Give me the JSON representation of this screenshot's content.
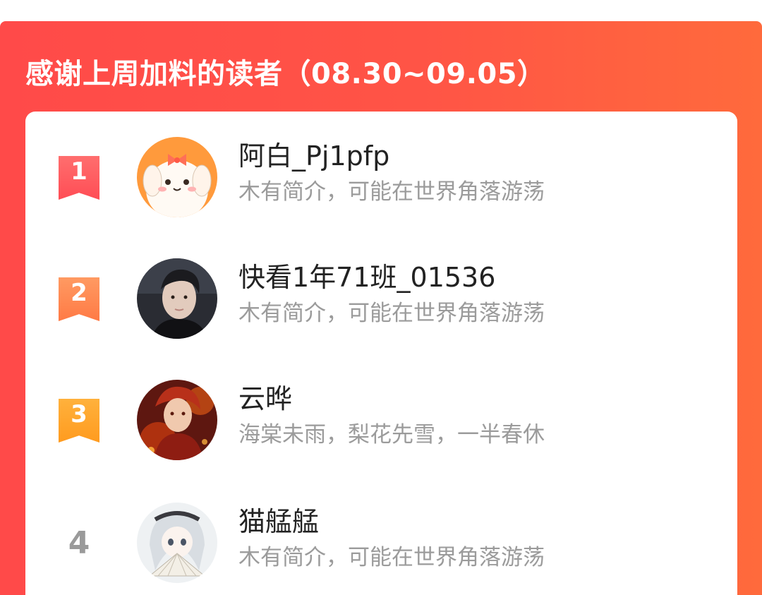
{
  "banner": {
    "title": "感谢上周加料的读者（08.30~09.05）"
  },
  "readers": [
    {
      "rank": "1",
      "name": "阿白_Pj1pfp",
      "bio": "木有简介，可能在世界角落游荡",
      "avatar": "puppy-cartoon-avatar"
    },
    {
      "rank": "2",
      "name": "快看1年71班_01536",
      "bio": "木有简介，可能在世界角落游荡",
      "avatar": "dark-portrait-avatar"
    },
    {
      "rank": "3",
      "name": "云晔",
      "bio": "海棠未雨，梨花先雪，一半春休",
      "avatar": "fire-anime-avatar"
    },
    {
      "rank": "4",
      "name": "猫艋艋",
      "bio": "木有简介，可能在世界角落游荡",
      "avatar": "anime-fan-avatar"
    }
  ],
  "colors": {
    "banner": "#ff4f48",
    "rank1": "#ff5a5f",
    "rank2": "#ff8550",
    "rank3": "#ffa52d",
    "rank_plain": "#9a9a9a"
  }
}
